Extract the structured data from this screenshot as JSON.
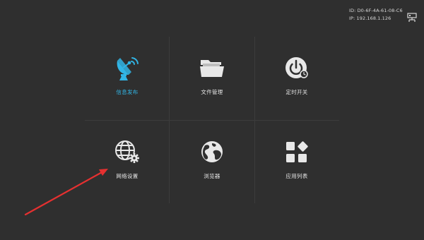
{
  "device": {
    "id_text": "ID: D0-6F-4A-61-08-C6",
    "ip_text": "IP: 192.168.1.126"
  },
  "tiles": [
    {
      "label": "信息发布",
      "icon": "satellite-dish-icon",
      "active": true
    },
    {
      "label": "文件管理",
      "icon": "folder-icon",
      "active": false
    },
    {
      "label": "定时开关",
      "icon": "power-timer-icon",
      "active": false
    },
    {
      "label": "网络设置",
      "icon": "globe-gear-icon",
      "active": false
    },
    {
      "label": "浏览器",
      "icon": "globe-icon",
      "active": false
    },
    {
      "label": "应用列表",
      "icon": "app-grid-icon",
      "active": false
    }
  ],
  "colors": {
    "background": "#2f2f2f",
    "accent": "#31b5e5",
    "text": "#e6e6e6",
    "annotation_arrow": "#e53030"
  }
}
